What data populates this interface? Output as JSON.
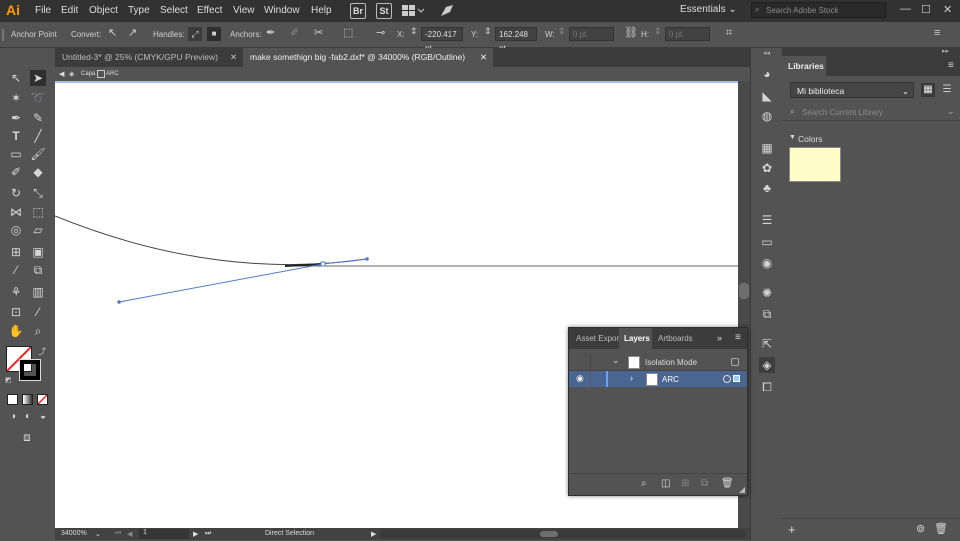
{
  "app": {
    "logo": "Ai",
    "menus": [
      "File",
      "Edit",
      "Object",
      "Type",
      "Select",
      "Effect",
      "View",
      "Window",
      "Help"
    ],
    "badges": [
      "Br",
      "St"
    ],
    "workspace": "Essentials",
    "search_placeholder": "Search Adobe Stock"
  },
  "control_bar": {
    "selection_label": "Anchor Point",
    "convert_label": "Convert:",
    "handles_label": "Handles:",
    "anchors_label": "Anchors:",
    "x_label": "X:",
    "x_value": "-220.417 pt",
    "y_label": "Y:",
    "y_value": "162.248 pt",
    "w_label": "W:",
    "w_value": "0 pt",
    "h_label": "H:",
    "h_value": "0 pt"
  },
  "tabs": [
    {
      "label": "Untitled-3* @ 25% (CMYK/GPU Preview)",
      "active": false
    },
    {
      "label": "make somethign big -fab2.dxf* @ 34000% (RGB/Outline)",
      "active": true
    }
  ],
  "breadcrumb": {
    "layer": "Capa",
    "object": "ARC"
  },
  "status": {
    "zoom": "34000%",
    "artboard": "1",
    "tool": "Direct Selection"
  },
  "libraries_panel": {
    "tab": "Libraries",
    "library_name": "Mi biblioteca",
    "search_placeholder": "Search Current Library",
    "section": "Colors",
    "swatch_color": "#fffcc7"
  },
  "layers_panel": {
    "tabs": [
      "Asset Expor",
      "Layers",
      "Artboards"
    ],
    "active_tab": "Layers",
    "rows": [
      {
        "name": "Isolation Mode"
      },
      {
        "name": "ARC"
      }
    ],
    "highlight_color": "#4a6590"
  },
  "colors": {
    "accent": "#ff9a00",
    "selection_blue": "#4f7ac7"
  }
}
